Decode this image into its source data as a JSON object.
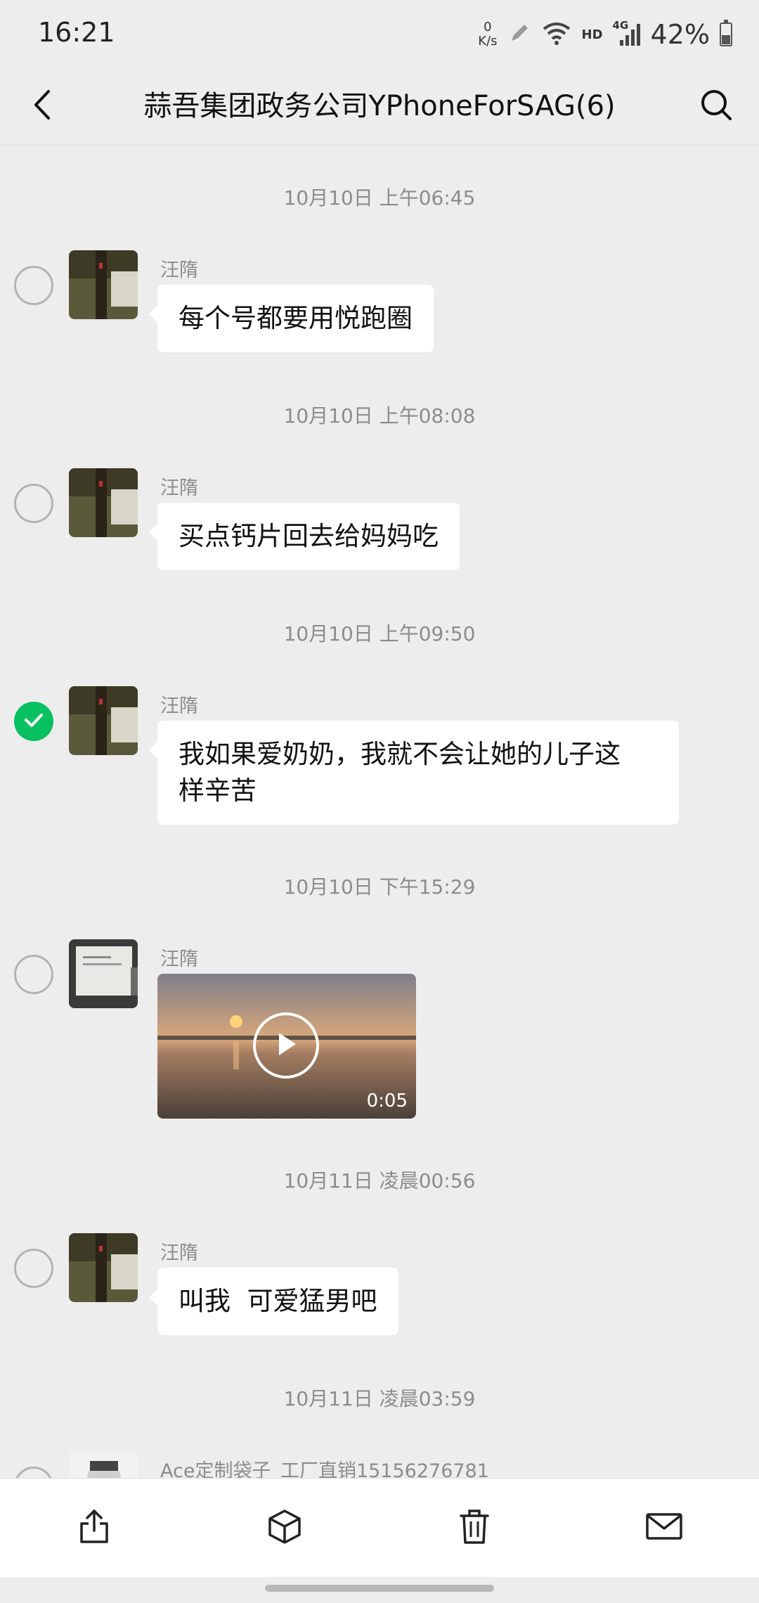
{
  "status_bar": {
    "time": "16:21",
    "net_speed_value": "0",
    "net_speed_unit": "K/s",
    "hd": "HD",
    "network": "4G",
    "battery": "42%",
    "battery_level": 0.42
  },
  "header": {
    "title": "蒜吾集团政务公司YPhoneForSAG(6)",
    "back_icon": "chevron-left-icon",
    "search_icon": "search-icon"
  },
  "messages": [
    {
      "timestamp": "10月10日 上午06:45",
      "sender": "汪隋",
      "text": "每个号都要用悦跑圈",
      "selected": false
    },
    {
      "timestamp": "10月10日 上午08:08",
      "sender": "汪隋",
      "text": "买点钙片回去给妈妈吃",
      "selected": false
    },
    {
      "timestamp": "10月10日 上午09:50",
      "sender": "汪隋",
      "text_line1": "我如果爱奶奶，我就不会让她的儿子这",
      "text_line2": "样辛苦",
      "selected": true
    },
    {
      "timestamp": "10月10日 下午15:29",
      "sender": "汪隋",
      "video_duration": "0:05",
      "selected": false
    },
    {
      "timestamp": "10月11日 凌晨00:56",
      "sender": "汪隋",
      "text": "叫我  可爱猛男吧",
      "selected": false
    },
    {
      "timestamp": "10月11日 凌晨03:59",
      "sender": "Ace定制袋子_工厂直销15156276781",
      "selected": false
    }
  ],
  "toolbar": {
    "items": [
      "share-icon",
      "favorite-box-icon",
      "trash-icon",
      "mail-icon"
    ]
  },
  "colors": {
    "background": "#EDEDED",
    "bubble": "#FFFFFF",
    "accent_green": "#07C160",
    "timestamp_text": "#8C8C8C"
  }
}
